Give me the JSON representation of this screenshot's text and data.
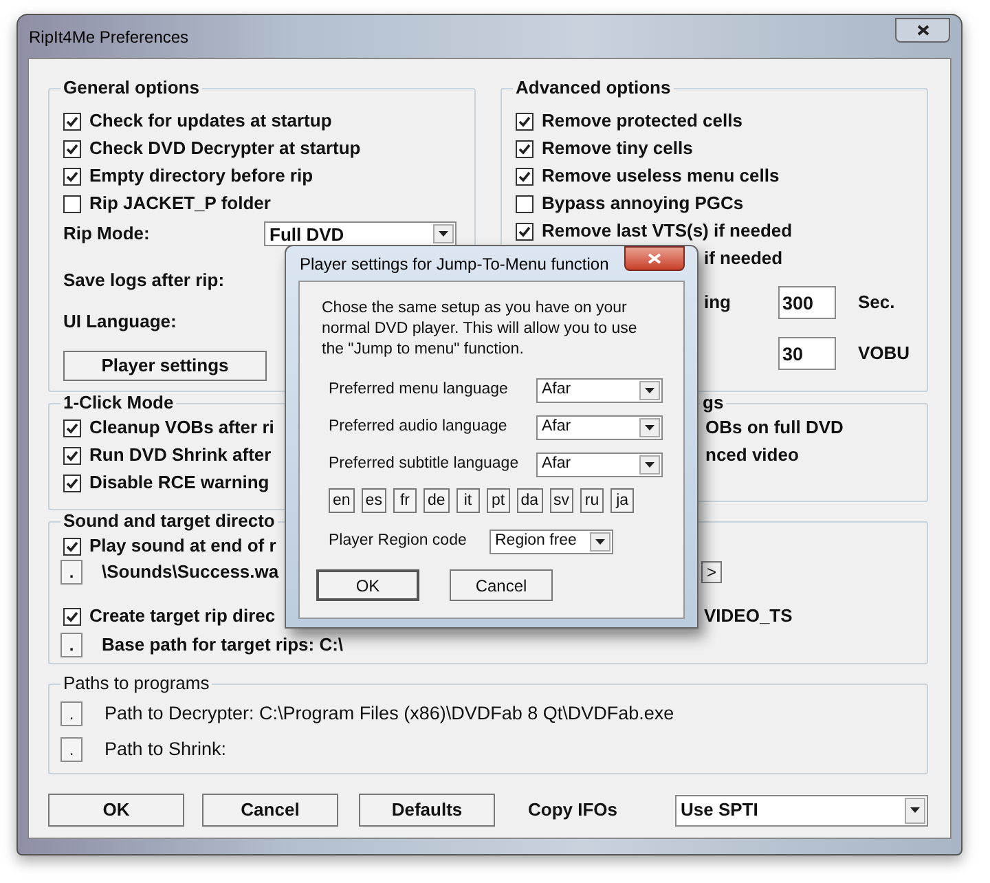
{
  "window": {
    "title": "RipIt4Me Preferences"
  },
  "general_options": {
    "title": "General options",
    "checkboxes": [
      {
        "label": "Check for updates at startup",
        "checked": true
      },
      {
        "label": "Check DVD Decrypter at startup",
        "checked": true
      },
      {
        "label": "Empty directory before rip",
        "checked": true
      },
      {
        "label": "Rip JACKET_P folder",
        "checked": false
      }
    ],
    "rip_mode": {
      "label": "Rip Mode:",
      "value": "Full DVD"
    },
    "save_logs": {
      "label": "Save logs after rip:"
    },
    "ui_language": {
      "label": "UI Language:"
    },
    "player_settings_button": "Player settings"
  },
  "advanced_options": {
    "title": "Advanced options",
    "checkboxes": [
      {
        "label": "Remove protected cells",
        "checked": true
      },
      {
        "label": "Remove tiny cells",
        "checked": true
      },
      {
        "label": "Remove useless menu cells",
        "checked": true
      },
      {
        "label": "Bypass annoying PGCs",
        "checked": false
      },
      {
        "label": "Remove last VTS(s) if needed",
        "checked": true
      }
    ],
    "partial_row": "if needed",
    "timeout": {
      "label": "ing",
      "value": "300",
      "unit": "Sec."
    },
    "vobu": {
      "value": "30",
      "unit": "VOBU"
    }
  },
  "one_click_mode": {
    "title": "1-Click Mode",
    "checkboxes": [
      {
        "label": "Cleanup VOBs after ri",
        "checked": true
      },
      {
        "label": "Run DVD Shrink after",
        "checked": true
      },
      {
        "label": "Disable RCE warning",
        "checked": true
      }
    ]
  },
  "settings_group": {
    "title": "gs",
    "rows": [
      "OBs on full DVD",
      "nced video"
    ]
  },
  "sound_and_target": {
    "title": "Sound and target directo",
    "play_sound": {
      "label": "Play sound at end of r",
      "checked": true
    },
    "sound_file": {
      "button": ".",
      "path": "\\Sounds\\Success.wa",
      "next_button": ">"
    },
    "create_target": {
      "label": "Create target rip direc",
      "checked": true,
      "tail": "VIDEO_TS"
    },
    "base_path": {
      "button": ".",
      "label": "Base path for target rips: C:\\"
    }
  },
  "paths_to_programs": {
    "title": "Paths to programs",
    "rows": [
      {
        "button": ".",
        "label": "Path to Decrypter: C:\\Program Files (x86)\\DVDFab 8 Qt\\DVDFab.exe"
      },
      {
        "button": ".",
        "label": "Path to Shrink:"
      }
    ]
  },
  "buttons": [
    "OK",
    "Cancel",
    "Defaults"
  ],
  "copy_ifos": {
    "label": "Copy IFOs",
    "value": "Use SPTI"
  },
  "dialog": {
    "title": "Player settings for Jump-To-Menu function",
    "description": "Chose the same setup as you have on your normal DVD player. This will allow you to use the \"Jump to menu\" function.",
    "languages": [
      {
        "label": "Preferred menu language",
        "value": "Afar"
      },
      {
        "label": "Preferred audio language",
        "value": "Afar"
      },
      {
        "label": "Preferred subtitle language",
        "value": "Afar"
      }
    ],
    "language_buttons": [
      "en",
      "es",
      "fr",
      "de",
      "it",
      "pt",
      "da",
      "sv",
      "ru",
      "ja"
    ],
    "region": {
      "label": "Player Region code",
      "value": "Region free"
    },
    "buttons": [
      "OK",
      "Cancel"
    ]
  }
}
